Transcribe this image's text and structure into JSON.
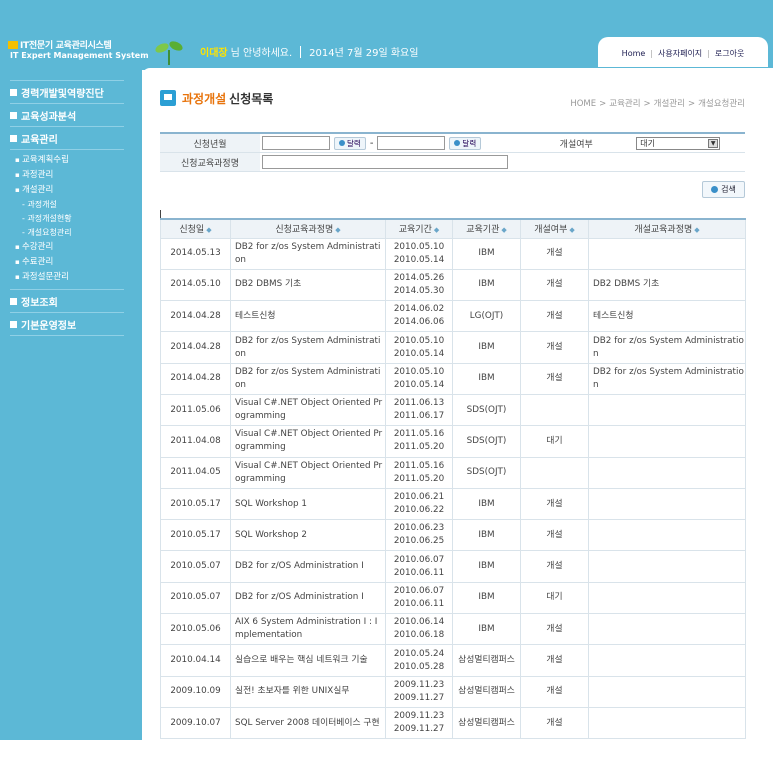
{
  "header": {
    "logo_title": "IT전문기 교육관리시스템",
    "logo_subtitle": "IT Expert Management System",
    "user_name": "이대장",
    "greeting": "님 안녕하세요.",
    "date": "2014년 7월 29일 화요일",
    "links": [
      "Home",
      "사용자페이지",
      "로그아웃"
    ]
  },
  "sidebar": {
    "items": [
      {
        "label": "경력개발및역량진단",
        "level": 1
      },
      {
        "label": "교육성과분석",
        "level": 1
      },
      {
        "label": "교육관리",
        "level": 1
      },
      {
        "label": "교육계획수립",
        "level": 2
      },
      {
        "label": "과정관리",
        "level": 2
      },
      {
        "label": "개설관리",
        "level": 2
      },
      {
        "label": "과정개설",
        "level": 3
      },
      {
        "label": "과정개설현황",
        "level": 3
      },
      {
        "label": "개설요청관리",
        "level": 3
      },
      {
        "label": "수강관리",
        "level": 2
      },
      {
        "label": "수료관리",
        "level": 2
      },
      {
        "label": "과정설문관리",
        "level": 2
      },
      {
        "label": "정보조회",
        "level": 1
      },
      {
        "label": "기본운영정보",
        "level": 1
      }
    ]
  },
  "page": {
    "title_highlight": "과정개설",
    "title_rest": "신청목록",
    "breadcrumb": [
      "HOME",
      "교육관리",
      "개설관리",
      "개설요청관리"
    ]
  },
  "search": {
    "date_label": "신청년월",
    "calendar_label": "달력",
    "range_sep": "-",
    "status_label": "개설여부",
    "status_value": "대기",
    "course_label": "신청교육과정명",
    "search_button": "검색"
  },
  "table": {
    "columns": [
      "신청일",
      "신청교육과정명",
      "교육기간",
      "교육기관",
      "개설여부",
      "개설교육과정명"
    ],
    "rows": [
      {
        "date": "2014.05.13",
        "course": "DB2 for z/os System Administration",
        "start": "2010.05.10",
        "end": "2010.05.14",
        "org": "IBM",
        "status": "개설",
        "opened": ""
      },
      {
        "date": "2014.05.10",
        "course": "DB2 DBMS 기초",
        "start": "2014.05.26",
        "end": "2014.05.30",
        "org": "IBM",
        "status": "개설",
        "opened": "DB2 DBMS 기초"
      },
      {
        "date": "2014.04.28",
        "course": "테스트신청",
        "start": "2014.06.02",
        "end": "2014.06.06",
        "org": "LG(OJT)",
        "status": "개설",
        "opened": "테스트신청"
      },
      {
        "date": "2014.04.28",
        "course": "DB2 for z/os System Administration",
        "start": "2010.05.10",
        "end": "2010.05.14",
        "org": "IBM",
        "status": "개설",
        "opened": "DB2 for z/os System Administration"
      },
      {
        "date": "2014.04.28",
        "course": "DB2 for z/os System Administration",
        "start": "2010.05.10",
        "end": "2010.05.14",
        "org": "IBM",
        "status": "개설",
        "opened": "DB2 for z/os System Administration"
      },
      {
        "date": "2011.05.06",
        "course": "Visual C#.NET Object Oriented Programming",
        "start": "2011.06.13",
        "end": "2011.06.17",
        "org": "SDS(OJT)",
        "status": "",
        "opened": ""
      },
      {
        "date": "2011.04.08",
        "course": "Visual C#.NET Object Oriented Programming",
        "start": "2011.05.16",
        "end": "2011.05.20",
        "org": "SDS(OJT)",
        "status": "대기",
        "opened": ""
      },
      {
        "date": "2011.04.05",
        "course": "Visual C#.NET Object Oriented Programming",
        "start": "2011.05.16",
        "end": "2011.05.20",
        "org": "SDS(OJT)",
        "status": "",
        "opened": ""
      },
      {
        "date": "2010.05.17",
        "course": "SQL Workshop 1",
        "start": "2010.06.21",
        "end": "2010.06.22",
        "org": "IBM",
        "status": "개설",
        "opened": ""
      },
      {
        "date": "2010.05.17",
        "course": "SQL Workshop 2",
        "start": "2010.06.23",
        "end": "2010.06.25",
        "org": "IBM",
        "status": "개설",
        "opened": ""
      },
      {
        "date": "2010.05.07",
        "course": "DB2 for z/OS Administration I",
        "start": "2010.06.07",
        "end": "2010.06.11",
        "org": "IBM",
        "status": "개설",
        "opened": ""
      },
      {
        "date": "2010.05.07",
        "course": "DB2 for z/OS Administration I",
        "start": "2010.06.07",
        "end": "2010.06.11",
        "org": "IBM",
        "status": "대기",
        "opened": ""
      },
      {
        "date": "2010.05.06",
        "course": "AIX 6 System Administration I : Implementation",
        "start": "2010.06.14",
        "end": "2010.06.18",
        "org": "IBM",
        "status": "개설",
        "opened": ""
      },
      {
        "date": "2010.04.14",
        "course": "실습으로 배우는 핵심 네트워크 기술",
        "start": "2010.05.24",
        "end": "2010.05.28",
        "org": "삼성멀티캠퍼스",
        "status": "개설",
        "opened": ""
      },
      {
        "date": "2009.10.09",
        "course": "실전! 초보자를 위한 UNIX실무",
        "start": "2009.11.23",
        "end": "2009.11.27",
        "org": "삼성멀티캠퍼스",
        "status": "개설",
        "opened": ""
      },
      {
        "date": "2009.10.07",
        "course": "SQL Server 2008 데이터베이스 구현",
        "start": "2009.11.23",
        "end": "2009.11.27",
        "org": "삼성멀티캠퍼스",
        "status": "개설",
        "opened": ""
      }
    ]
  }
}
